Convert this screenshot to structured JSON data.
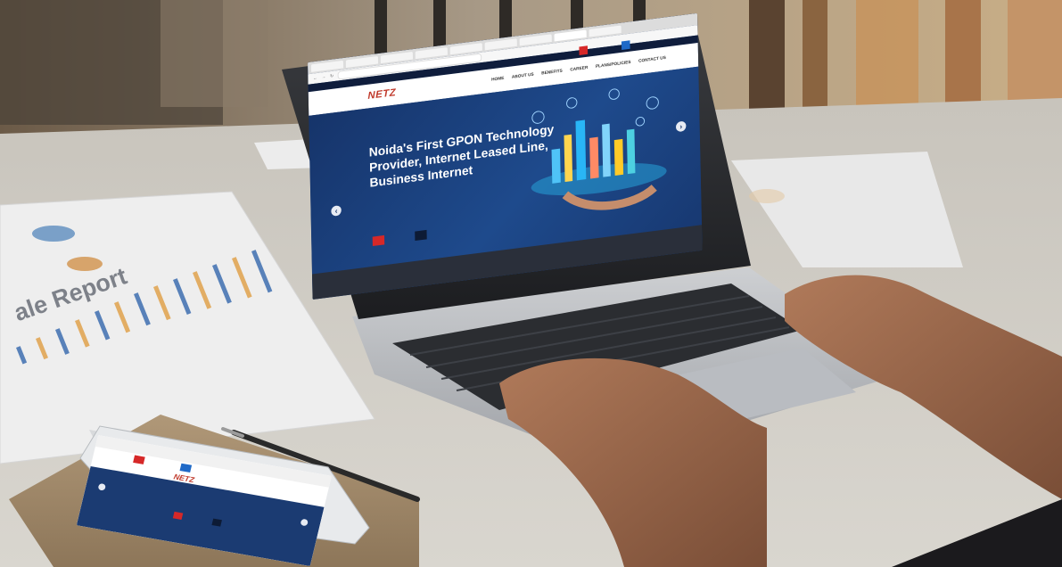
{
  "laptop": {
    "tabs": [
      "",
      "",
      "",
      "",
      "",
      "",
      "",
      "",
      ""
    ],
    "url": "",
    "topstrip": [
      "",
      ""
    ],
    "utility_buttons": [
      "",
      ""
    ],
    "logo": "NETZ",
    "nav": [
      "HOME",
      "ABOUT US",
      "BENEFITS",
      "CAREER",
      "PLANS/POLICIES",
      "CONTACT US"
    ],
    "headline": "Noida's First GPON Technology Provider, Internet Leased Line, Business Internet",
    "subtext": "",
    "buttons": [
      "",
      ""
    ]
  },
  "phone": {
    "top": "",
    "utility_buttons": [
      "",
      ""
    ],
    "logo": "NETZ",
    "headline": "",
    "buttons": [
      "",
      ""
    ]
  },
  "paper": {
    "report_title": "ale Report"
  },
  "colors": {
    "brand_red": "#d62828",
    "brand_blue": "#1f69c7",
    "hero_navy": "#1d3a6b"
  }
}
